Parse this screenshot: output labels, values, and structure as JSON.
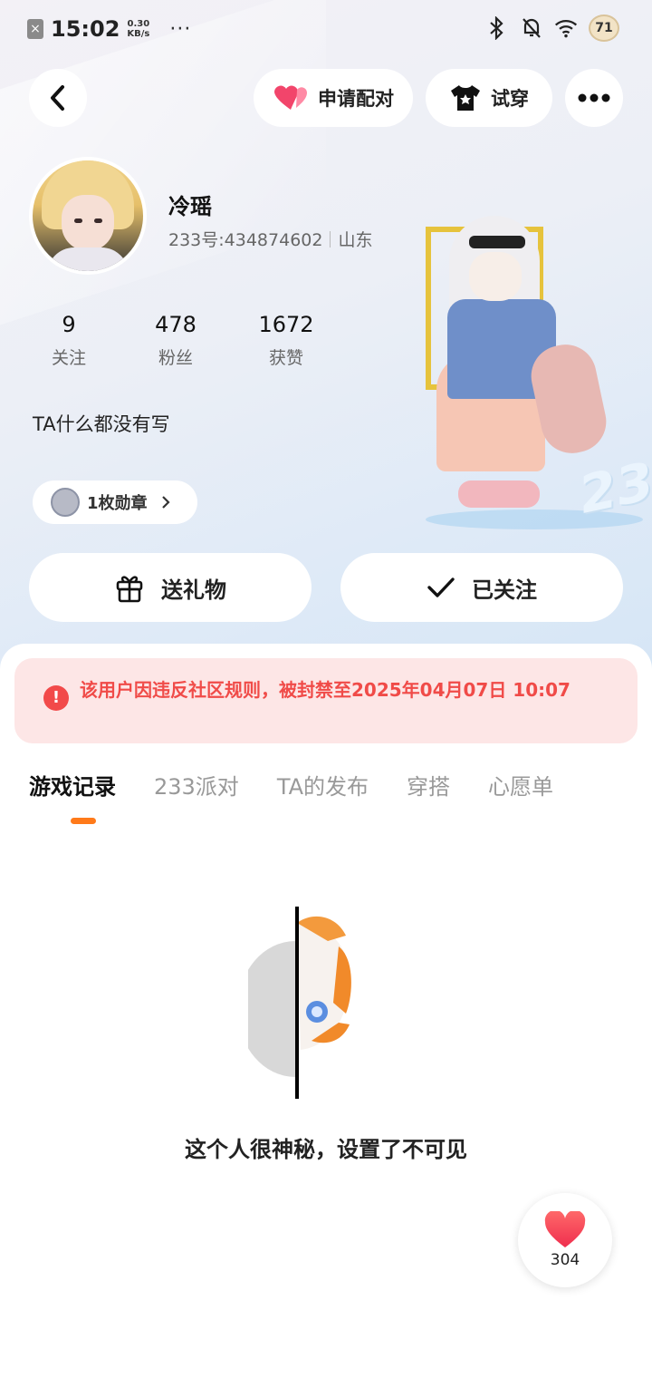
{
  "status_bar": {
    "time": "15:02",
    "net_speed_value": "0.30",
    "net_speed_unit": "KB/s",
    "more": "···",
    "battery": "71"
  },
  "header": {
    "pair_label": "申请配对",
    "tryon_label": "试穿"
  },
  "profile": {
    "nickname": "冷瑶",
    "id_text": "233号:434874602",
    "location": "山东",
    "bio": "TA什么都没有写",
    "medal_label": "1枚勋章"
  },
  "stats": [
    {
      "value": "9",
      "label": "关注"
    },
    {
      "value": "478",
      "label": "粉丝"
    },
    {
      "value": "1672",
      "label": "获赞"
    }
  ],
  "decor": {
    "big_233": "233"
  },
  "actions": {
    "gift_label": "送礼物",
    "follow_label": "已关注"
  },
  "notice": {
    "ban_text": "该用户因违反社区规则，被封禁至2025年04月07日 10:07"
  },
  "tabs": [
    "游戏记录",
    "233派对",
    "TA的发布",
    "穿搭",
    "心愿单"
  ],
  "empty": {
    "message": "这个人很神秘，设置了不可见"
  },
  "like": {
    "count": "304"
  },
  "colors": {
    "accent": "#ff7a1a",
    "ban_text": "#f04b48",
    "ban_bg": "#fde6e6",
    "heart": "#f2456b"
  }
}
